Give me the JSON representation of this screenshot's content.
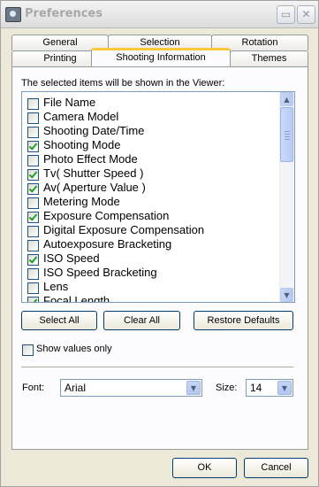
{
  "window": {
    "title": "Preferences"
  },
  "tabs_row1": [
    {
      "label": "General"
    },
    {
      "label": "Selection"
    },
    {
      "label": "Rotation"
    }
  ],
  "tabs_row2": [
    {
      "label": "Printing"
    },
    {
      "label": "Shooting Information",
      "active": true
    },
    {
      "label": "Themes"
    }
  ],
  "panel": {
    "instruction": "The selected items will be shown in the Viewer:",
    "items": [
      {
        "label": "File Name",
        "checked": false
      },
      {
        "label": "Camera Model",
        "checked": false
      },
      {
        "label": "Shooting Date/Time",
        "checked": false
      },
      {
        "label": "Shooting Mode",
        "checked": true
      },
      {
        "label": "Photo Effect Mode",
        "checked": false
      },
      {
        "label": "Tv( Shutter Speed )",
        "checked": true
      },
      {
        "label": "Av( Aperture Value )",
        "checked": true
      },
      {
        "label": "Metering Mode",
        "checked": false
      },
      {
        "label": "Exposure Compensation",
        "checked": true
      },
      {
        "label": "Digital Exposure Compensation",
        "checked": false
      },
      {
        "label": "Autoexposure Bracketing",
        "checked": false
      },
      {
        "label": "ISO Speed",
        "checked": true
      },
      {
        "label": "ISO Speed Bracketing",
        "checked": false
      },
      {
        "label": "Lens",
        "checked": false
      },
      {
        "label": "Focal Length",
        "checked": true
      }
    ],
    "select_all_label": "Select All",
    "clear_all_label": "Clear All",
    "restore_defaults_label": "Restore Defaults",
    "show_values_only_label": "Show values only",
    "show_values_only_checked": false,
    "font_label": "Font:",
    "font_value": "Arial",
    "size_label": "Size:",
    "size_value": "14"
  },
  "footer": {
    "ok_label": "OK",
    "cancel_label": "Cancel"
  },
  "colors": {
    "accent_tab": "#ffc83c",
    "check": "#21a121",
    "button_border": "#003c74"
  }
}
